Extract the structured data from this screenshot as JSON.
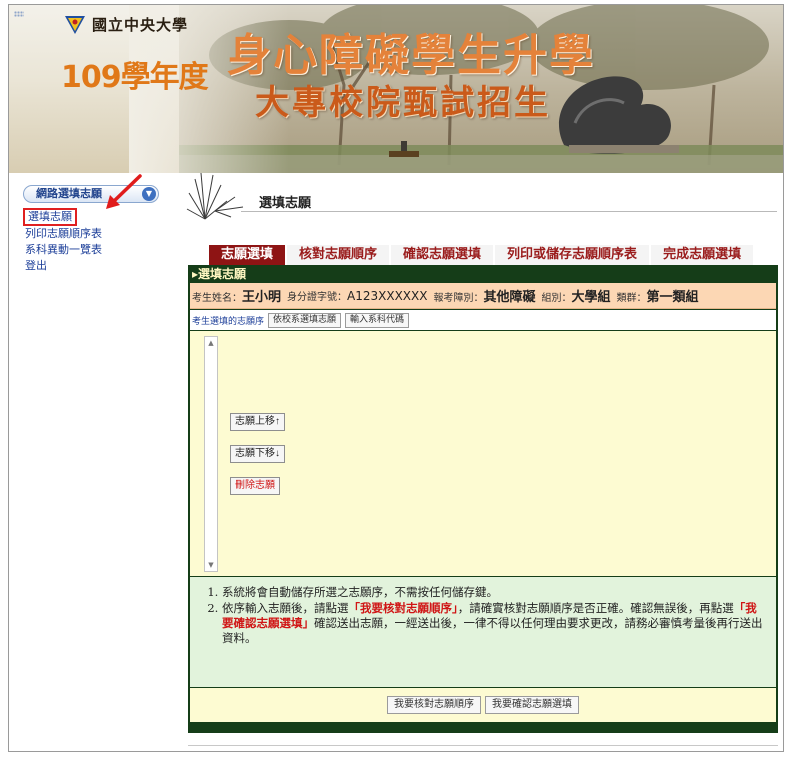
{
  "header": {
    "university": "國立中央大學",
    "year": "109學年度",
    "title_main": "身心障礙學生升學",
    "title_sub": "大專校院甄試招生"
  },
  "sidebar": {
    "menu_label": "網路選填志願",
    "items": [
      {
        "label": "選填志願",
        "active": true
      },
      {
        "label": "列印志願順序表",
        "active": false
      },
      {
        "label": "系科異動一覽表",
        "active": false
      },
      {
        "label": "登出",
        "active": false
      }
    ]
  },
  "page": {
    "heading": "選填志願"
  },
  "steps": [
    {
      "label": "志願選填",
      "active": true
    },
    {
      "label": "核對志願順序",
      "active": false
    },
    {
      "label": "確認志願選填",
      "active": false
    },
    {
      "label": "列印或儲存志願順序表",
      "active": false
    },
    {
      "label": "完成志願選填",
      "active": false
    }
  ],
  "panel": {
    "title": "▸選填志願",
    "candidate": {
      "name_label": "考生姓名：",
      "name": "王小明",
      "id_label": "身分證字號：",
      "id": "A123XXXXXX",
      "category_label": "報考障別：",
      "category": "其他障礙",
      "group_label": "組別：",
      "group": "大學組",
      "cluster_label": "類群：",
      "cluster": "第一類組"
    },
    "toolbar": {
      "label": "考生選填的志願序",
      "btn_by_school": "依校系選填志願",
      "btn_input_code": "輸入系科代碼"
    },
    "list_buttons": {
      "move_up": "志願上移↑",
      "move_down": "志願下移↓",
      "delete": "刪除志願"
    },
    "notes": {
      "n1": "系統將會自動儲存所選之志願序，不需按任何儲存鍵。",
      "n2_a": "依序輸入志願後，請點選",
      "n2_h1": "「我要核對志願順序」",
      "n2_b": "，請確實核對志願順序是否正確。確認無誤後，再點選",
      "n2_h2": "「我要確認志願選填」",
      "n2_c": "確認送出志願，一經送出後，一律不得以任何理由要求更改，請務必審慎考量後再行送出資料。"
    },
    "bottom": {
      "btn_check": "我要核對志願順序",
      "btn_confirm": "我要確認志願選填"
    }
  },
  "colors": {
    "panel_bg": "#153d18",
    "step_active": "#8e1414",
    "info_row": "#fcd7b4",
    "list_bg": "#fdfbd2",
    "notes_bg": "#e2f3dc",
    "highlight": "#d01515"
  }
}
